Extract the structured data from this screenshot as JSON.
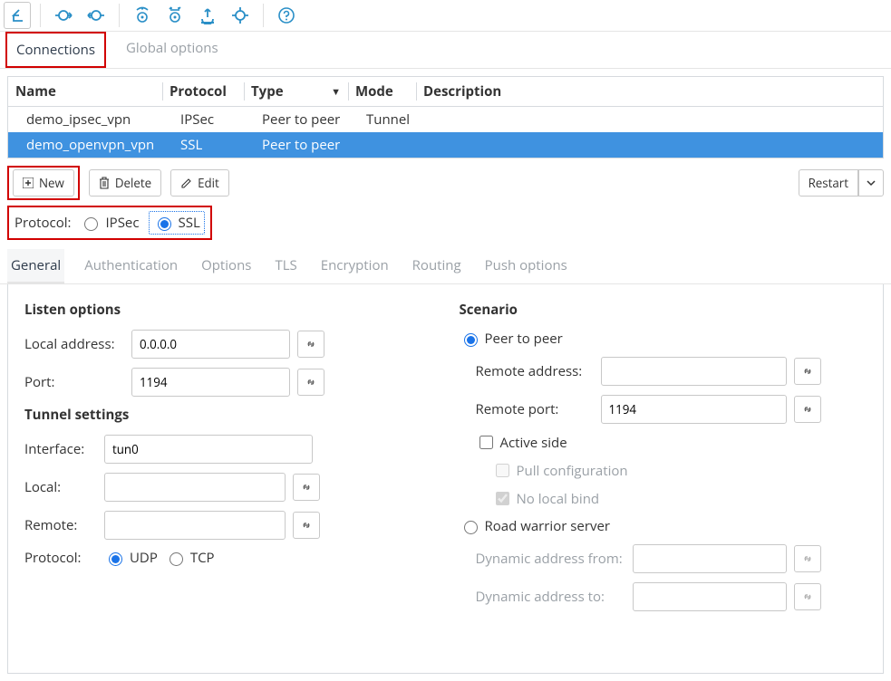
{
  "top_tabs": {
    "connections": "Connections",
    "global": "Global options"
  },
  "table": {
    "head": {
      "name": "Name",
      "protocol": "Protocol",
      "type": "Type",
      "mode": "Mode",
      "description": "Description"
    },
    "rows": [
      {
        "name": "demo_ipsec_vpn",
        "protocol": "IPSec",
        "type": "Peer to peer",
        "mode": "Tunnel",
        "description": ""
      },
      {
        "name": "demo_openvpn_vpn",
        "protocol": "SSL",
        "type": "Peer to peer",
        "mode": "",
        "description": ""
      }
    ]
  },
  "actions": {
    "new": "New",
    "delete": "Delete",
    "edit": "Edit",
    "restart": "Restart"
  },
  "proto_label": "Protocol:",
  "proto_opts": {
    "ipsec": "IPSec",
    "ssl": "SSL"
  },
  "sub_tabs": {
    "general": "General",
    "auth": "Authentication",
    "options": "Options",
    "tls": "TLS",
    "enc": "Encryption",
    "routing": "Routing",
    "push": "Push options"
  },
  "listen": {
    "title": "Listen options",
    "local_address_label": "Local address:",
    "local_address_value": "0.0.0.0",
    "port_label": "Port:",
    "port_value": "1194"
  },
  "tunnel": {
    "title": "Tunnel settings",
    "interface_label": "Interface:",
    "interface_value": "tun0",
    "local_label": "Local:",
    "local_value": "",
    "remote_label": "Remote:",
    "remote_value": "",
    "protocol_label": "Protocol:",
    "udp": "UDP",
    "tcp": "TCP"
  },
  "scenario": {
    "title": "Scenario",
    "p2p": "Peer to peer",
    "remote_addr_label": "Remote address:",
    "remote_addr_value": "",
    "remote_port_label": "Remote port:",
    "remote_port_value": "1194",
    "active_side": "Active side",
    "pull_cfg": "Pull configuration",
    "no_local_bind": "No local bind",
    "road_warrior": "Road warrior server",
    "dyn_from_label": "Dynamic address from:",
    "dyn_from_value": "",
    "dyn_to_label": "Dynamic address to:",
    "dyn_to_value": ""
  }
}
